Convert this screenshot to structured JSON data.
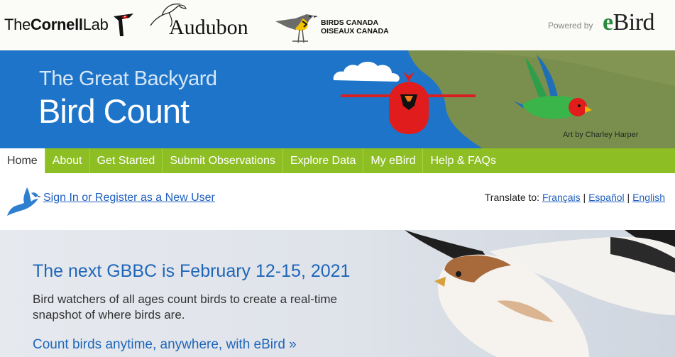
{
  "partners": {
    "cornell_prefix": "The",
    "cornell_bold": "Cornell",
    "cornell_suffix": "Lab",
    "audubon": "Audubon",
    "birds_canada_en": "BIRDS CANADA",
    "birds_canada_fr": "OISEAUX CANADA",
    "powered_by": "Powered by",
    "ebird_e": "e",
    "ebird_rest": "Bird"
  },
  "banner": {
    "title_small": "The Great Backyard",
    "title_big": "Bird Count",
    "art_credit": "Art by Charley Harper"
  },
  "nav": {
    "items": [
      {
        "label": "Home",
        "active": true
      },
      {
        "label": "About"
      },
      {
        "label": "Get Started"
      },
      {
        "label": "Submit Observations"
      },
      {
        "label": "Explore Data"
      },
      {
        "label": "My eBird"
      },
      {
        "label": "Help & FAQs"
      }
    ]
  },
  "account": {
    "signin_label": "Sign In or Register as a New User",
    "translate_label": "Translate to:",
    "languages": [
      "Français",
      "Español",
      "English"
    ],
    "separator": "|"
  },
  "hero": {
    "title": "The next GBBC is February 12-15, 2021",
    "text": "Bird watchers of all ages count birds to create a real-time snapshot of where birds are.",
    "link": "Count birds anytime, anywhere, with eBird »"
  },
  "colors": {
    "banner_blue": "#1e74c9",
    "nav_green": "#8dbf24",
    "link_blue": "#1f5fbf",
    "hero_title_blue": "#1f66b8",
    "ebird_green": "#2b8a3e"
  }
}
